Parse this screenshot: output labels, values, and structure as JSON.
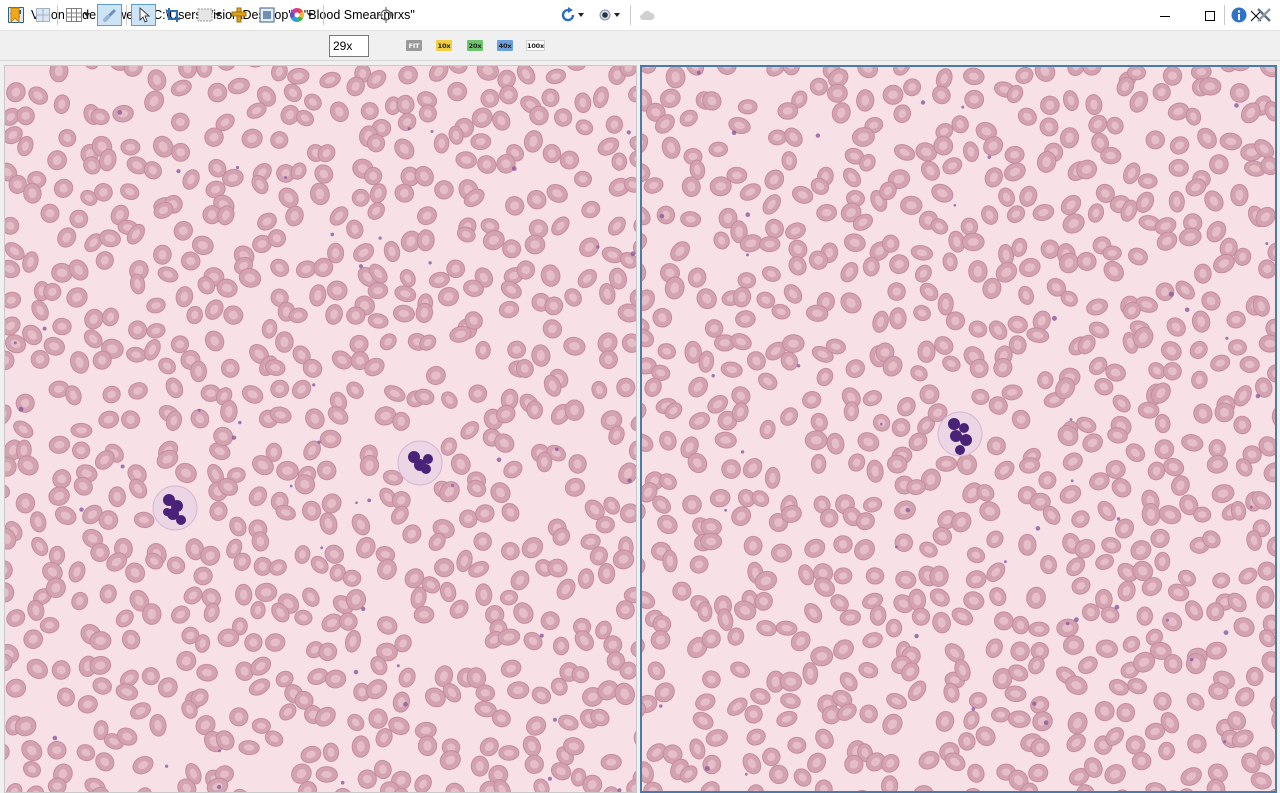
{
  "window": {
    "title": "Vision Slide Viewer - \"C:\\Users\\Vision\\Desktop\" - \"Blood Smear.mrxs\"",
    "controls": [
      "minimize",
      "maximize",
      "close"
    ]
  },
  "toolbar": {
    "zoom_value": "29x",
    "magnifications": [
      {
        "label": "FIT",
        "color": "#9a9a9a"
      },
      {
        "label": "10x",
        "color": "#f0d040"
      },
      {
        "label": "20x",
        "color": "#6cc46c"
      },
      {
        "label": "40x",
        "color": "#6aa0dc"
      },
      {
        "label": "100x",
        "color": "#ffffff"
      }
    ],
    "icons": [
      "bookmark-icon",
      "split-view-icon",
      "grid-icon",
      "link-icon",
      "select-pointer-icon",
      "crop-icon",
      "rectangle-annotation-icon",
      "measure-icon",
      "image-export-icon",
      "color-wheel-icon",
      "center-target-icon",
      "rotate-icon",
      "brightness-icon",
      "cloud-icon",
      "info-icon",
      "tools-icon"
    ]
  },
  "viewers": [
    {
      "name": "left-slide-view",
      "selected": false
    },
    {
      "name": "right-slide-view",
      "selected": true
    }
  ],
  "colors": {
    "rbc_fill": "#d4a3b1",
    "rbc_rim": "#c48b9e",
    "rbc_pale": "#e7c3cc",
    "background": "#f8e1e6",
    "nucleus": "#4a2378",
    "selected_border": "#4a7aa8"
  }
}
